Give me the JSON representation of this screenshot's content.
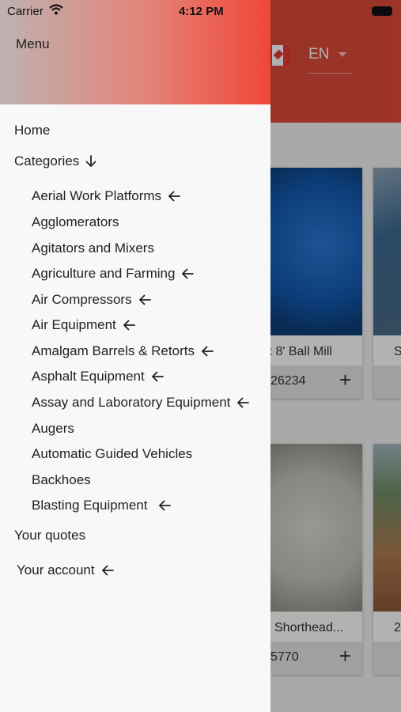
{
  "status_bar": {
    "carrier": "Carrier",
    "time": "4:12 PM"
  },
  "header": {
    "language": "EN"
  },
  "products": [
    {
      "title": "x 8' Ball Mill",
      "number": "26234"
    },
    {
      "title": "S",
      "number": ""
    },
    {
      "title": "Shorthead...",
      "number": "5770"
    },
    {
      "title": "2",
      "number": ""
    }
  ],
  "drawer": {
    "title": "Menu",
    "home": "Home",
    "categories": "Categories",
    "category_items": [
      "Aerial Work Platforms",
      "Agglomerators",
      "Agitators and Mixers",
      "Agriculture and Farming",
      "Air Compressors",
      "Air Equipment",
      "Amalgam Barrels & Retorts",
      "Asphalt Equipment",
      "Assay and Laboratory Equipment",
      "Augers",
      "Automatic Guided Vehicles",
      "Backhoes",
      "Blasting Equipment"
    ],
    "quotes": "Your quotes",
    "account": "Your account"
  },
  "colors": {
    "header_red": "#ef4636",
    "drawer_bg": "#f8f8f8"
  }
}
